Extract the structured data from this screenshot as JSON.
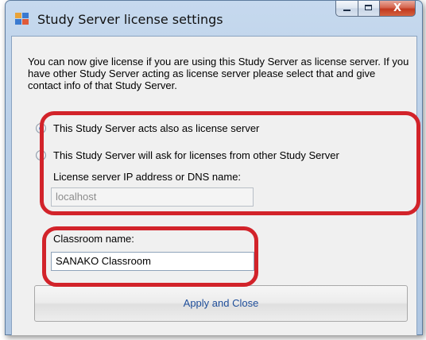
{
  "window": {
    "title": "Study Server license settings",
    "icon": "app-window-icon"
  },
  "caption": {
    "minimize_icon": "minimize-icon",
    "maximize_icon": "maximize-icon",
    "close_icon": "close-icon",
    "close_glyph": "X"
  },
  "intro_text": "You can now give license if you are using this Study Server as license server. If you have other Study Server acting as license server please select that and give contact info of that Study Server.",
  "license_options": [
    {
      "label": "This Study Server acts also as license server",
      "selected": true
    },
    {
      "label": "This Study Server will ask for licenses from other Study Server",
      "selected": false
    }
  ],
  "license_server": {
    "label": "License server IP address or DNS name:",
    "value": "localhost",
    "enabled": false
  },
  "classroom": {
    "label": "Classroom name:",
    "value": "SANAKO Classroom"
  },
  "apply_button": "Apply and Close",
  "colors": {
    "highlight": "#d2232a",
    "link_text": "#1f4e9a",
    "radio_selected": "#2f7fd1"
  }
}
